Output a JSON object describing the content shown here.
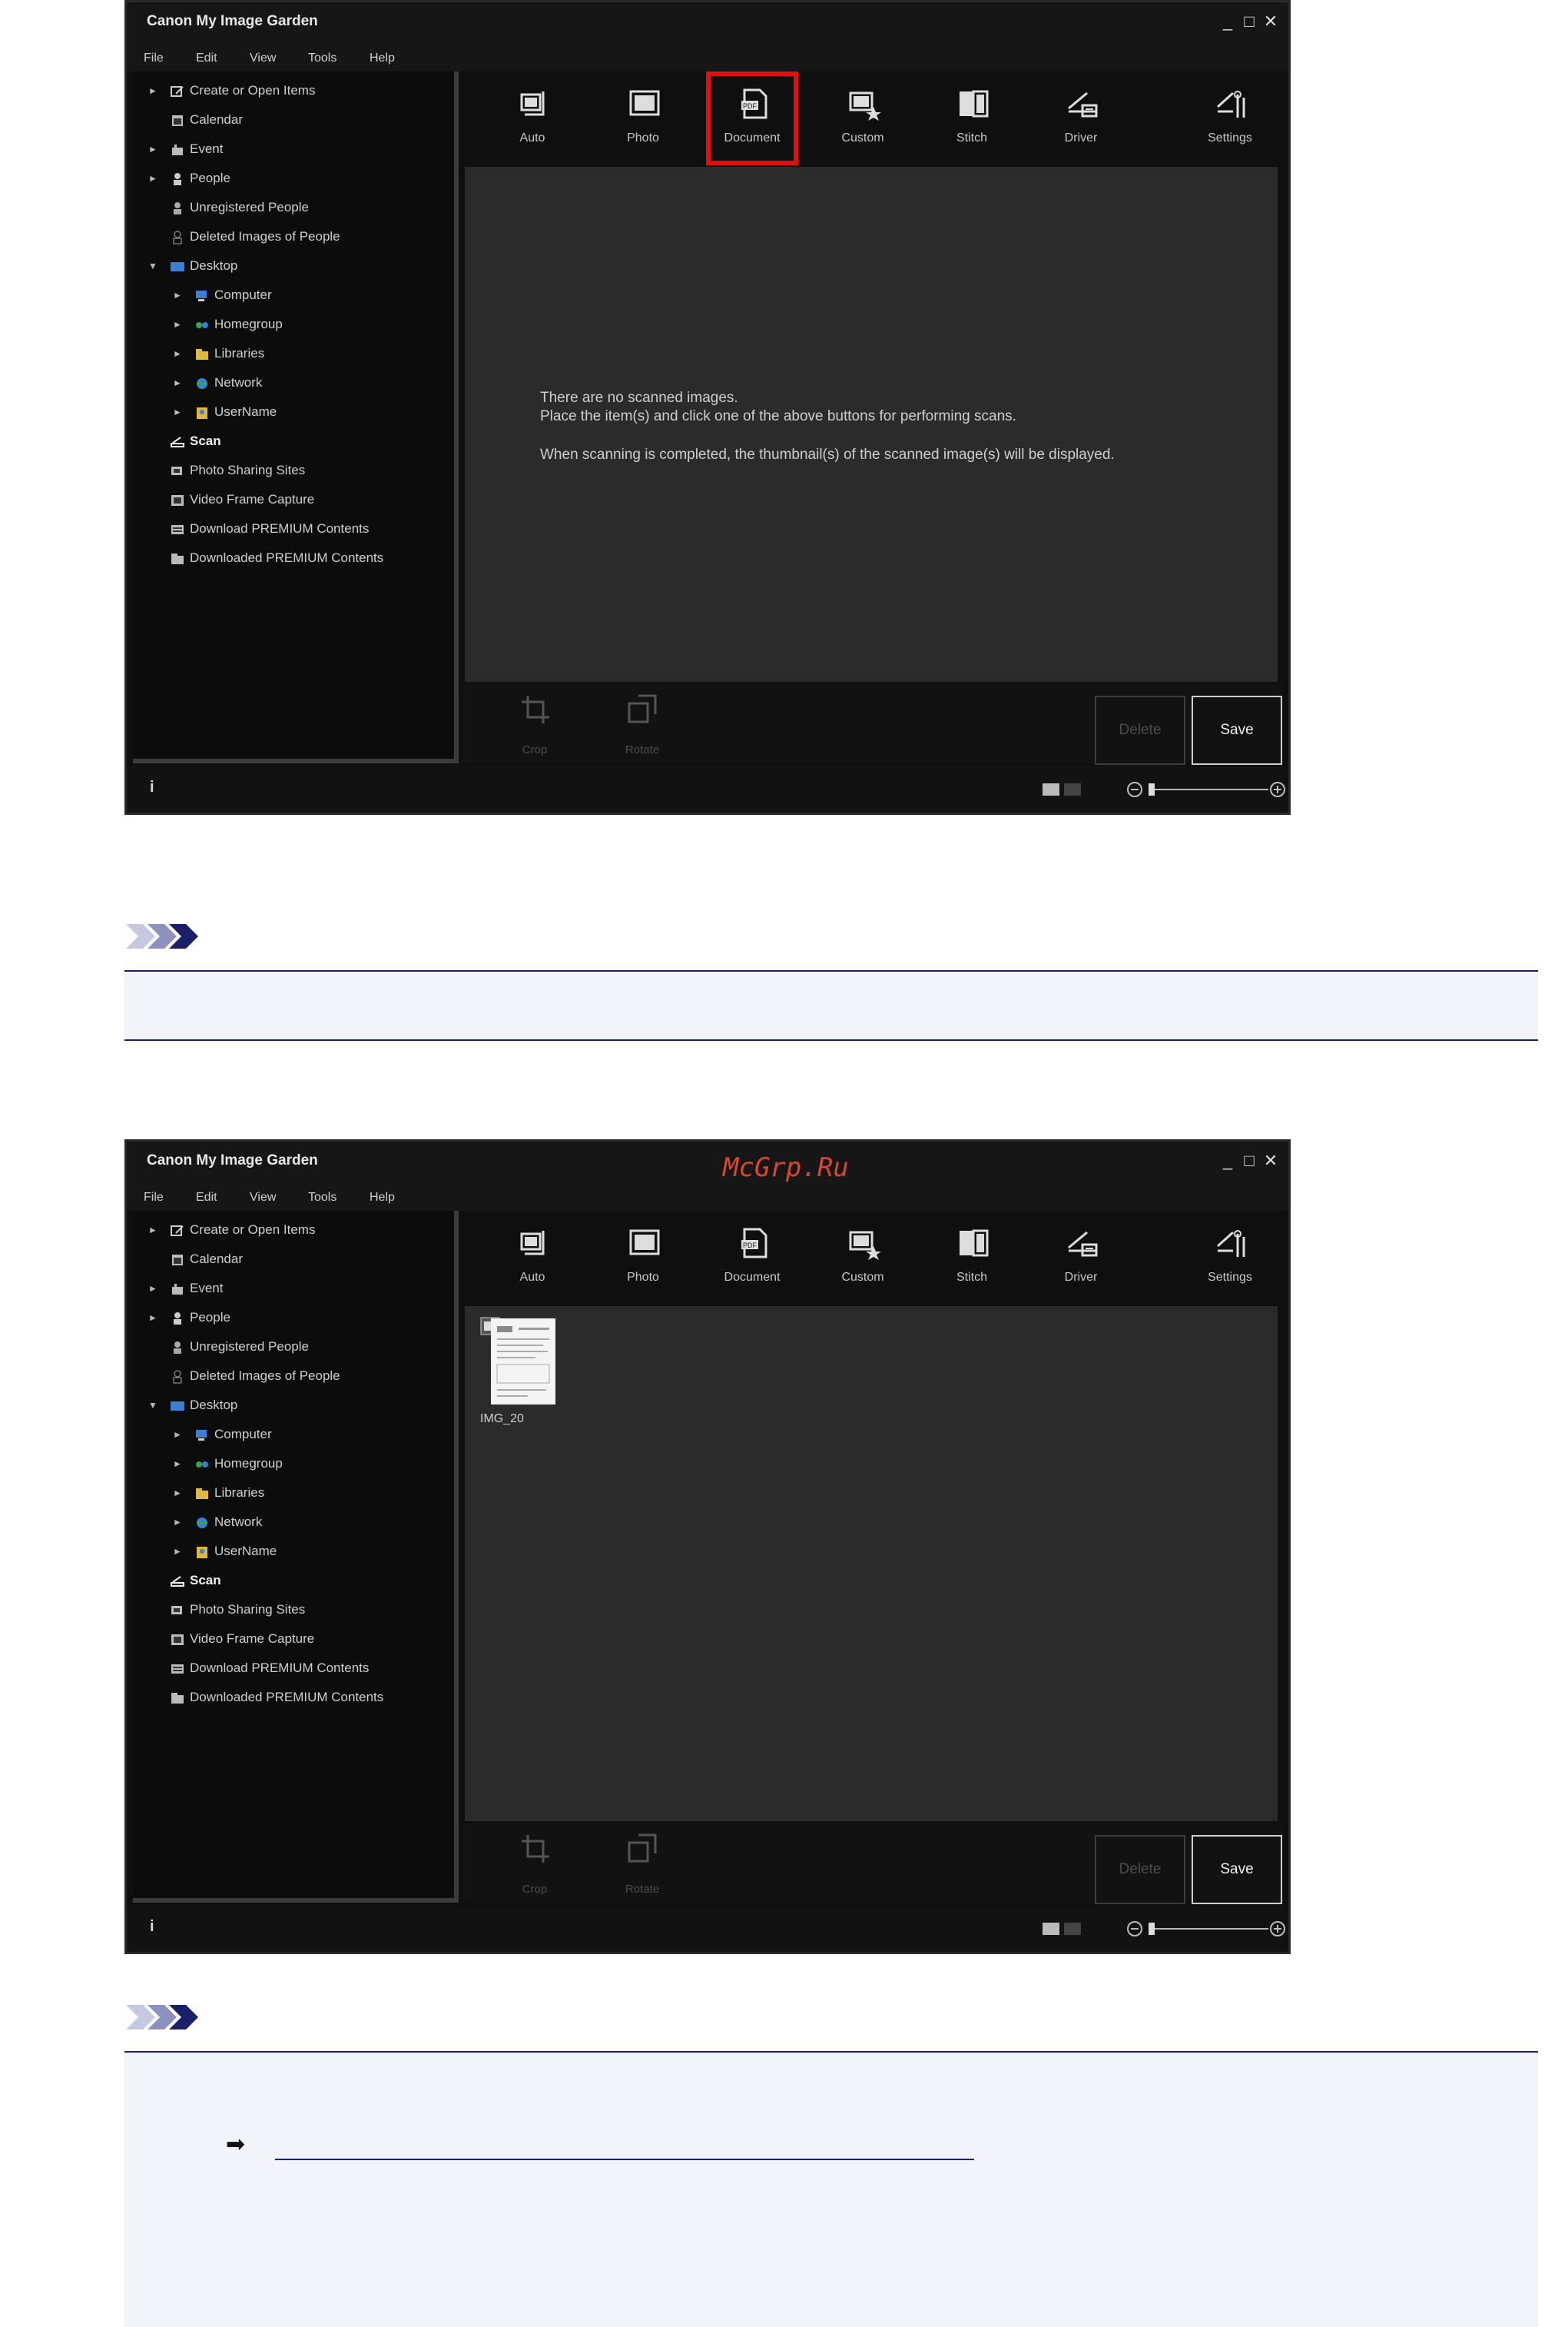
{
  "app": {
    "title": "Canon My Image Garden",
    "menu": [
      "File",
      "Edit",
      "View",
      "Tools",
      "Help"
    ],
    "window_controls": [
      "_",
      "□",
      "✕"
    ]
  },
  "sidebar": {
    "items": [
      {
        "label": "Create or Open Items",
        "icon": "create-items-icon",
        "level": 1,
        "expander": "►"
      },
      {
        "label": "Calendar",
        "icon": "calendar-icon",
        "level": 1,
        "expander": ""
      },
      {
        "label": "Event",
        "icon": "event-icon",
        "level": 1,
        "expander": "►"
      },
      {
        "label": "People",
        "icon": "person-icon",
        "level": 1,
        "expander": "►"
      },
      {
        "label": "Unregistered People",
        "icon": "unregistered-person-icon",
        "level": 1,
        "expander": ""
      },
      {
        "label": "Deleted Images of People",
        "icon": "deleted-person-icon",
        "level": 1,
        "expander": ""
      },
      {
        "label": "Desktop",
        "icon": "desktop-icon",
        "level": 1,
        "expander": "▼"
      },
      {
        "label": "Computer",
        "icon": "computer-icon",
        "level": 2,
        "expander": "►"
      },
      {
        "label": "Homegroup",
        "icon": "homegroup-icon",
        "level": 2,
        "expander": "►"
      },
      {
        "label": "Libraries",
        "icon": "libraries-icon",
        "level": 2,
        "expander": "►"
      },
      {
        "label": "Network",
        "icon": "network-icon",
        "level": 2,
        "expander": "►"
      },
      {
        "label": "UserName",
        "icon": "user-folder-icon",
        "level": 2,
        "expander": "►"
      },
      {
        "label": "Scan",
        "icon": "scan-icon",
        "level": 1,
        "expander": "",
        "selected": true
      },
      {
        "label": "Photo Sharing Sites",
        "icon": "photo-sharing-icon",
        "level": 1,
        "expander": ""
      },
      {
        "label": "Video Frame Capture",
        "icon": "video-frame-icon",
        "level": 1,
        "expander": ""
      },
      {
        "label": "Download PREMIUM Contents",
        "icon": "download-icon",
        "level": 1,
        "expander": ""
      },
      {
        "label": "Downloaded PREMIUM Contents",
        "icon": "downloaded-icon",
        "level": 1,
        "expander": ""
      }
    ]
  },
  "toolbar": {
    "tools": [
      "Auto",
      "Photo",
      "Document",
      "Custom",
      "Stitch",
      "Driver",
      "Settings"
    ],
    "highlighted_first_screen": "Document"
  },
  "content_first": {
    "line1": "There are no scanned images.",
    "line2": "Place the item(s) and click one of the above buttons for performing scans.",
    "line3": "When scanning is completed, the thumbnail(s) of the scanned image(s) will be displayed."
  },
  "content_second": {
    "thumbnail_label": "IMG_20"
  },
  "bottom": {
    "crop": "Crop",
    "rotate": "Rotate",
    "delete": "Delete",
    "save": "Save"
  },
  "status": {
    "info": "i"
  },
  "watermark": "McGrp.Ru",
  "colors": {
    "highlight": "#e01010",
    "rule": "#1a1f6a",
    "notebox": "#f3f4fa"
  }
}
